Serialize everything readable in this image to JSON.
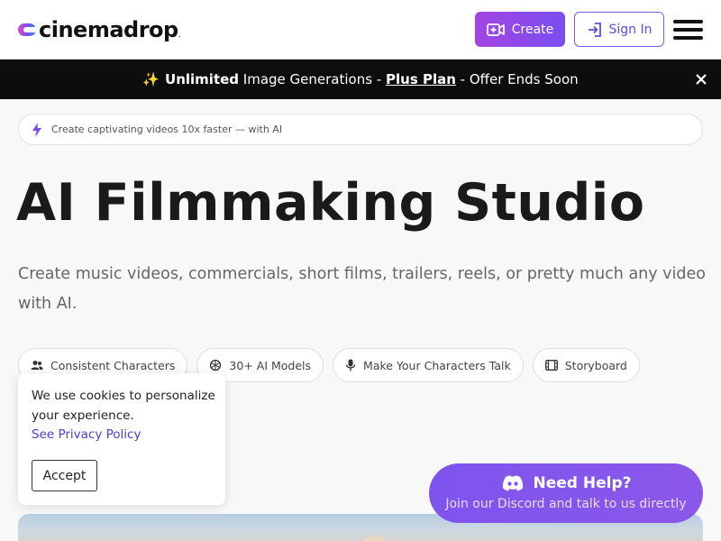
{
  "header": {
    "logo_text": "cinemadrop",
    "logo_mark": ".",
    "create_label": "Create",
    "signin_label": "Sign In"
  },
  "promo": {
    "emoji": "✨",
    "unlimited": "Unlimited",
    "text1": " Image Generations - ",
    "plus": "Plus Plan",
    "text2": " - Offer Ends Soon"
  },
  "tagline": "Create captivating videos 10x faster — with AI",
  "title": "AI Filmmaking Studio",
  "subtitle": "Create music videos, commercials, short films, trailers, reels, or pretty much any video with AI.",
  "chips": [
    {
      "label": "Consistent Characters",
      "icon": "users-icon"
    },
    {
      "label": "30+ AI Models",
      "icon": "openai-icon"
    },
    {
      "label": "Make Your Characters Talk",
      "icon": "microphone-icon"
    },
    {
      "label": "Storyboard",
      "icon": "film-icon"
    }
  ],
  "cookie": {
    "text": "We use cookies to personalize your experience.",
    "link": "See Privacy Policy",
    "accept": "Accept"
  },
  "help": {
    "title": "Need Help?",
    "subtitle": "Join our Discord and talk to us directly"
  },
  "colors": {
    "accent": "#7b4df0",
    "promo_bg": "#0d0d0d",
    "help_bg": "#7e54ee"
  }
}
